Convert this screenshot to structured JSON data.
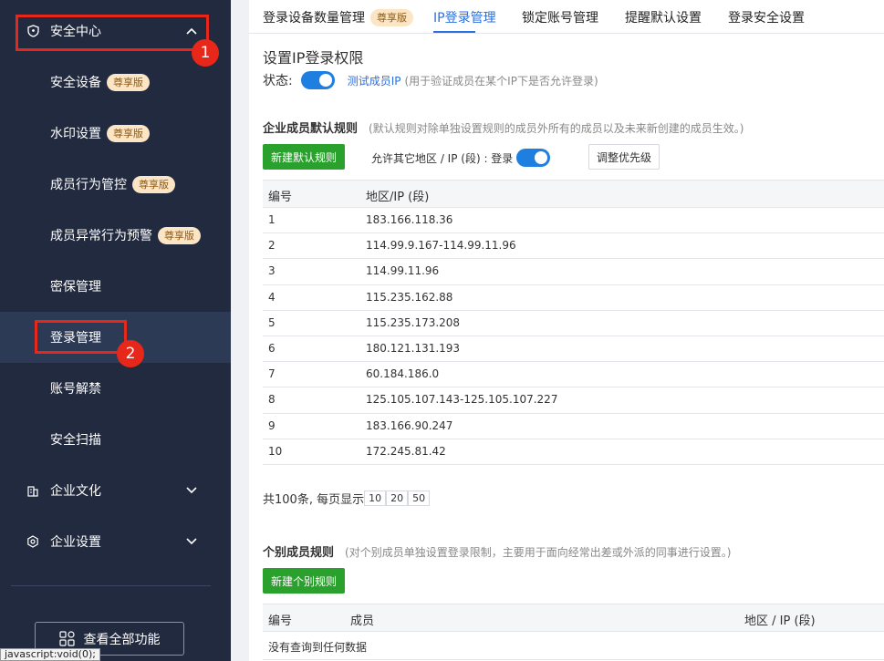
{
  "sidebar": {
    "security_center": "安全中心",
    "sub_items": [
      {
        "label": "安全设备",
        "badge": "尊享版"
      },
      {
        "label": "水印设置",
        "badge": "尊享版"
      },
      {
        "label": "成员行为管控",
        "badge": "尊享版"
      },
      {
        "label": "成员异常行为预警",
        "badge": "尊享版"
      },
      {
        "label": "密保管理",
        "badge": ""
      },
      {
        "label": "登录管理",
        "badge": ""
      },
      {
        "label": "账号解禁",
        "badge": ""
      },
      {
        "label": "安全扫描",
        "badge": ""
      }
    ],
    "culture": "企业文化",
    "settings": "企业设置",
    "all_functions": "查看全部功能",
    "annotations": [
      "1",
      "2"
    ]
  },
  "statusbar": "javascript:void(0);",
  "tabs": [
    {
      "label": "登录设备数量管理",
      "badge": "尊享版"
    },
    {
      "label": "IP登录管理",
      "badge": ""
    },
    {
      "label": "锁定账号管理",
      "badge": ""
    },
    {
      "label": "提醒默认设置",
      "badge": ""
    },
    {
      "label": "登录安全设置",
      "badge": ""
    }
  ],
  "ip_section": {
    "title": "设置IP登录权限",
    "status_label": "状态:",
    "status_on": true,
    "test_link": "测试成员IP",
    "test_hint": "(用于验证成员在某个IP下是否允许登录)"
  },
  "default_rules": {
    "title": "企业成员默认规则",
    "hint": "(默认规则对除单独设置规则的成员外所有的成员以及未来新创建的成员生效。)",
    "new_button": "新建默认规则",
    "allow_label": "允许其它地区 / IP (段) : 登录",
    "allow_on": true,
    "priority_button": "调整优先级",
    "columns": [
      "编号",
      "地区/IP (段)"
    ],
    "rows": [
      [
        "1",
        "183.166.118.36"
      ],
      [
        "2",
        "114.99.9.167-114.99.11.96"
      ],
      [
        "3",
        "114.99.11.96"
      ],
      [
        "4",
        "115.235.162.88"
      ],
      [
        "5",
        "115.235.173.208"
      ],
      [
        "6",
        "180.121.131.193"
      ],
      [
        "7",
        "60.184.186.0"
      ],
      [
        "8",
        "125.105.107.143-125.105.107.227"
      ],
      [
        "9",
        "183.166.90.247"
      ],
      [
        "10",
        "172.245.81.42"
      ]
    ],
    "pager_text": "共100条, 每页显示",
    "page_sizes": [
      "10",
      "20",
      "50"
    ]
  },
  "individual_rules": {
    "title": "个别成员规则",
    "hint": "(对个别成员单独设置登录限制，主要用于面向经常出差或外派的同事进行设置。)",
    "new_button": "新建个别规则",
    "columns": [
      "编号",
      "成员",
      "地区 / IP (段)"
    ],
    "empty_text": "没有查询到任何数据"
  }
}
